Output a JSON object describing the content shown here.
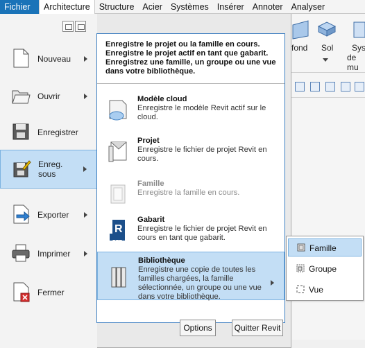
{
  "ribbon": {
    "tabs": [
      {
        "label": "Fichier"
      },
      {
        "label": "Architecture"
      },
      {
        "label": "Structure"
      },
      {
        "label": "Acier"
      },
      {
        "label": "Systèmes"
      },
      {
        "label": "Insérer"
      },
      {
        "label": "Annoter"
      },
      {
        "label": "Analyser"
      }
    ],
    "right_labels": {
      "fond": "fond",
      "sol": "Sol",
      "sys1": "Sys",
      "sys2": "de mu"
    }
  },
  "app_menu": {
    "items": [
      {
        "label": "Nouveau",
        "icon": "new-file-icon",
        "has_submenu": true
      },
      {
        "label": "Ouvrir",
        "icon": "open-folder-icon",
        "has_submenu": true
      },
      {
        "label": "Enregistrer",
        "icon": "save-icon",
        "has_submenu": false
      },
      {
        "label": "Enreg.\nsous",
        "icon": "save-as-icon",
        "has_submenu": true,
        "highlighted": true
      },
      {
        "label": "Exporter",
        "icon": "export-icon",
        "has_submenu": true
      },
      {
        "label": "Imprimer",
        "icon": "printer-icon",
        "has_submenu": true
      },
      {
        "label": "Fermer",
        "icon": "close-file-icon",
        "has_submenu": false
      }
    ],
    "footer": {
      "options_label": "Options",
      "quit_label": "Quitter Revit"
    }
  },
  "save_as_submenu": {
    "header": "Enregistre le projet ou la famille en cours. Enregistre le projet actif en tant que gabarit. Enregistrez une famille, un groupe ou une vue dans votre bibliothèque.",
    "items": [
      {
        "title": "Modèle cloud",
        "desc": "Enregistre le modèle Revit actif sur le cloud.",
        "icon": "cloud-model-icon"
      },
      {
        "title": "Projet",
        "desc": "Enregistre le fichier de projet Revit en cours.",
        "icon": "project-icon"
      },
      {
        "title": "Famille",
        "desc": "Enregistre la famille en cours.",
        "icon": "family-icon",
        "disabled": true
      },
      {
        "title": "Gabarit",
        "desc": "Enregistre le fichier de projet Revit en cours en tant que gabarit.",
        "icon": "template-rte-icon",
        "badge": "RTE"
      },
      {
        "title": "Bibliothèque",
        "desc": "Enregistre une copie de toutes les familles chargées, la famille sélectionnée, un groupe ou une vue dans votre bibliothèque.",
        "icon": "library-icon",
        "highlighted": true
      }
    ]
  },
  "library_flyout": {
    "items": [
      {
        "label": "Famille",
        "icon": "family-small-icon",
        "highlighted": true
      },
      {
        "label": "Groupe",
        "icon": "group-icon"
      },
      {
        "label": "Vue",
        "icon": "view-icon"
      }
    ]
  },
  "colors": {
    "file_tab": "#1a73b8",
    "highlight": "#c3def5",
    "highlight_border": "#7bb2e0",
    "submenu_border": "#3a7cc0"
  }
}
